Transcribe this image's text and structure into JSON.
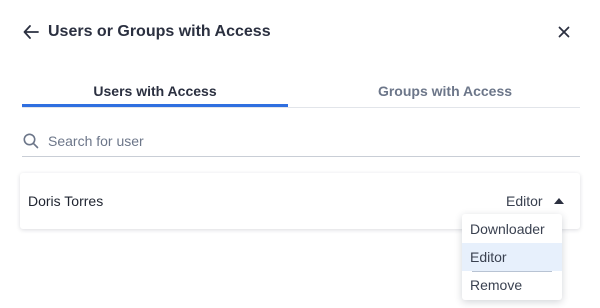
{
  "header": {
    "title": "Users or Groups with Access",
    "back_icon": "arrow-left-icon",
    "close_icon": "close-icon"
  },
  "tabs": [
    {
      "label": "Users with Access",
      "active": true
    },
    {
      "label": "Groups with Access",
      "active": false
    }
  ],
  "search": {
    "placeholder": "Search for user",
    "value": ""
  },
  "users": [
    {
      "name": "Doris Torres",
      "role": "Editor"
    }
  ],
  "role_dropdown": {
    "open": true,
    "selected": "Editor",
    "options": [
      "Downloader",
      "Editor",
      "Remove"
    ]
  },
  "colors": {
    "accent": "#2f6fe0",
    "selected_option_bg": "#e7f0fc",
    "muted_text": "#6c7689"
  }
}
